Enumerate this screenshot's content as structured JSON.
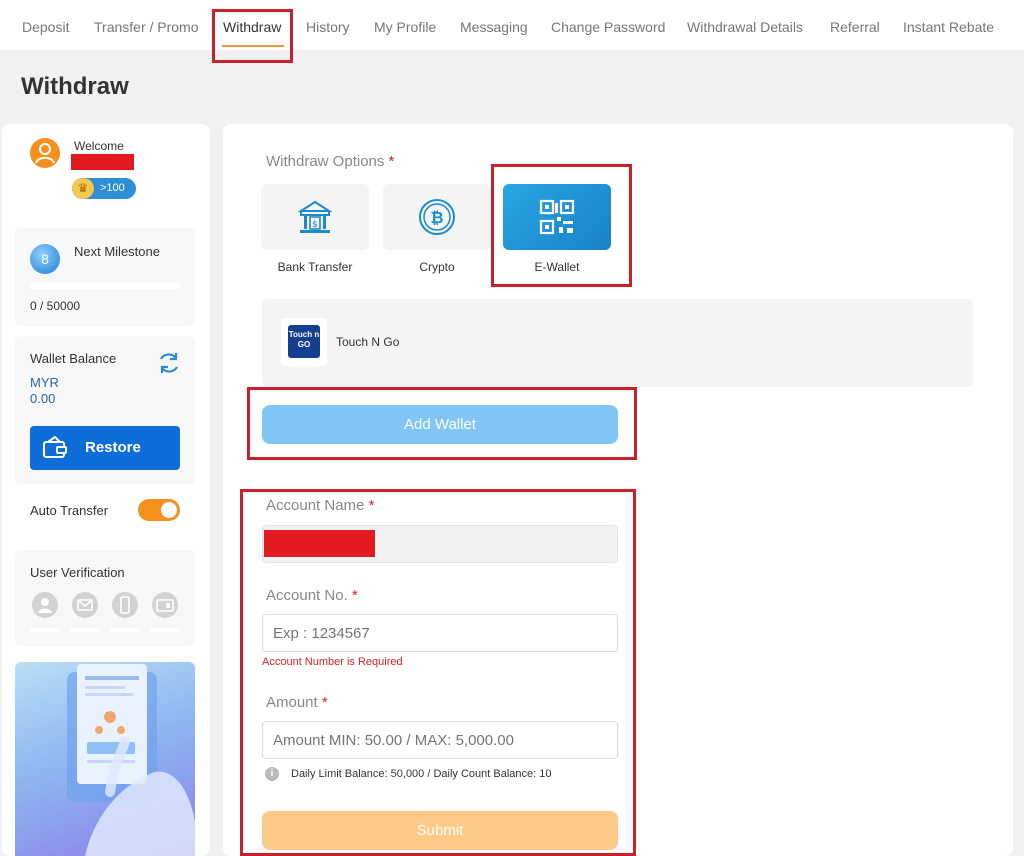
{
  "nav": {
    "items": [
      {
        "label": "Deposit"
      },
      {
        "label": "Transfer / Promo"
      },
      {
        "label": "Withdraw"
      },
      {
        "label": "History"
      },
      {
        "label": "My Profile"
      },
      {
        "label": "Messaging"
      },
      {
        "label": "Change Password"
      },
      {
        "label": "Withdrawal Details"
      },
      {
        "label": "Referral"
      },
      {
        "label": "Instant Rebate"
      }
    ],
    "active_index": 2
  },
  "page": {
    "title": "Withdraw"
  },
  "sidebar": {
    "welcome": "Welcome",
    "vip_badge": ">100",
    "milestone": {
      "label": "Next Milestone",
      "progress_text": "0 / 50000",
      "current": 0,
      "target": 50000,
      "level_icon": "8"
    },
    "wallet": {
      "label": "Wallet Balance",
      "currency": "MYR",
      "amount": "0.00",
      "restore_label": "Restore"
    },
    "auto_transfer": {
      "label": "Auto Transfer",
      "enabled": true
    },
    "verification": {
      "label": "User Verification",
      "icons": [
        "user-icon",
        "mail-icon",
        "phone-icon",
        "id-card-icon"
      ]
    }
  },
  "withdraw": {
    "options_label": "Withdraw Options",
    "required_mark": "*",
    "options": [
      {
        "label": "Bank Transfer",
        "icon": "bank-icon",
        "selected": false
      },
      {
        "label": "Crypto",
        "icon": "bitcoin-icon",
        "selected": false
      },
      {
        "label": "E-Wallet",
        "icon": "qr-code-icon",
        "selected": true
      }
    ],
    "wallet_item": {
      "label": "Touch N Go",
      "logo_text": "Touch n GO"
    },
    "add_wallet_label": "Add Wallet",
    "account_name": {
      "label": "Account Name",
      "value": ""
    },
    "account_no": {
      "label": "Account No.",
      "placeholder": "Exp : 1234567",
      "error": "Account Number is Required"
    },
    "amount": {
      "label": "Amount",
      "placeholder": "Amount MIN: 50.00 / MAX: 5,000.00"
    },
    "limit_text": "Daily Limit Balance: 50,000 / Daily Count Balance: 10",
    "submit_label": "Submit"
  },
  "colors": {
    "accent_orange": "#f5901e",
    "primary_blue": "#0e6ed9",
    "highlight_red": "#c9202c",
    "add_wallet_bg": "#80c5f6",
    "submit_bg": "#fcc987",
    "error_red": "#d8222a"
  }
}
